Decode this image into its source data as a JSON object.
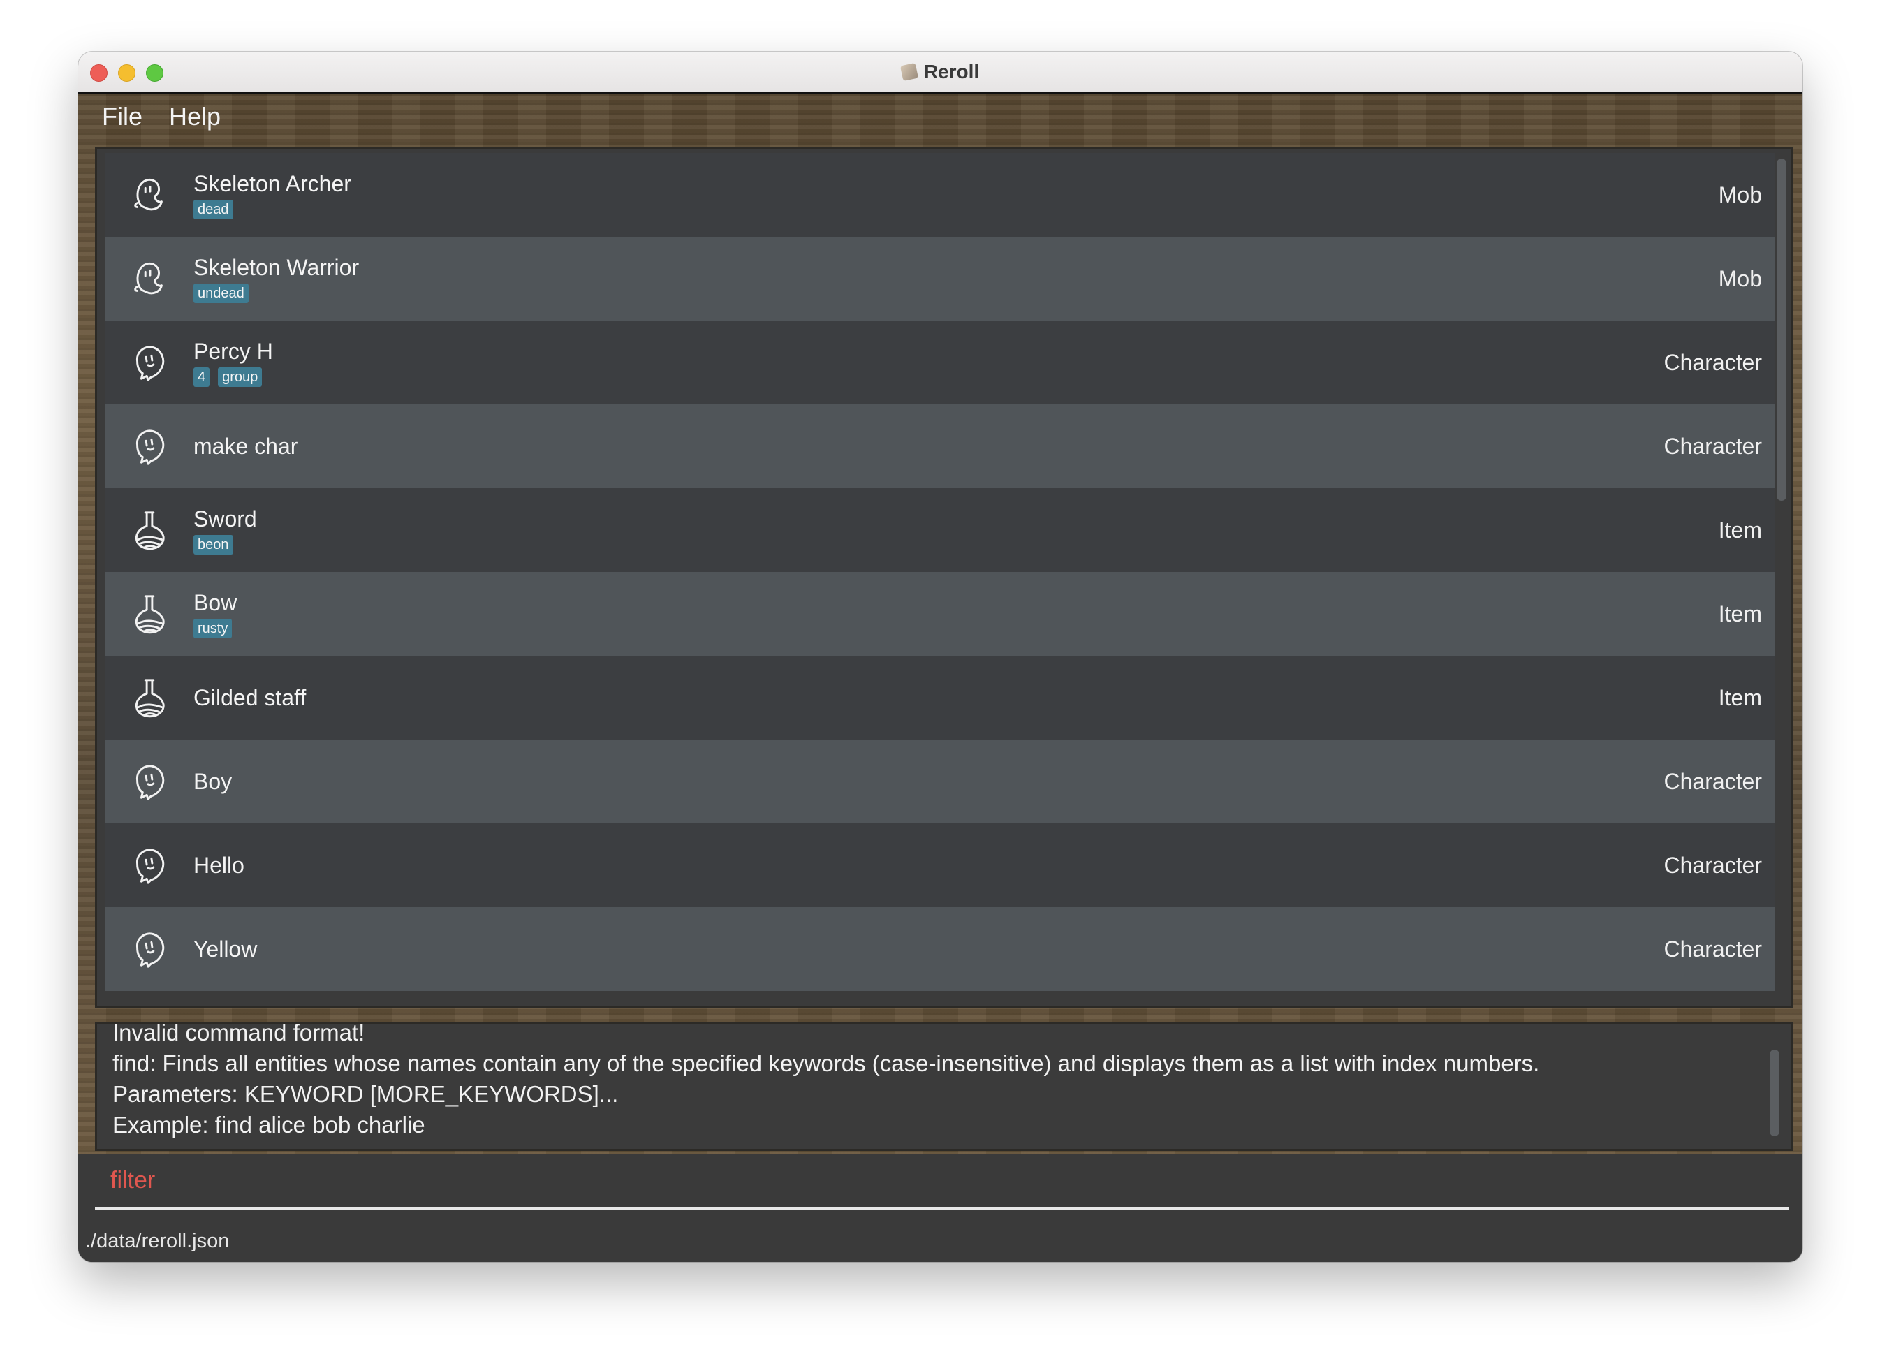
{
  "window": {
    "title": "Reroll"
  },
  "menu": {
    "file": "File",
    "help": "Help"
  },
  "entities": [
    {
      "name": "Skeleton Archer",
      "tags": [
        "dead"
      ],
      "type": "Mob",
      "icon": "ghost-icon"
    },
    {
      "name": "Skeleton Warrior",
      "tags": [
        "undead"
      ],
      "type": "Mob",
      "icon": "ghost-icon"
    },
    {
      "name": "Percy H",
      "tags": [
        "4",
        "group"
      ],
      "type": "Character",
      "icon": "character-icon"
    },
    {
      "name": "make char",
      "tags": [],
      "type": "Character",
      "icon": "character-icon"
    },
    {
      "name": "Sword",
      "tags": [
        "beon"
      ],
      "type": "Item",
      "icon": "potion-icon"
    },
    {
      "name": "Bow",
      "tags": [
        "rusty"
      ],
      "type": "Item",
      "icon": "potion-icon"
    },
    {
      "name": "Gilded staff",
      "tags": [],
      "type": "Item",
      "icon": "potion-icon"
    },
    {
      "name": "Boy",
      "tags": [],
      "type": "Character",
      "icon": "character-icon"
    },
    {
      "name": "Hello",
      "tags": [],
      "type": "Character",
      "icon": "character-icon"
    },
    {
      "name": "Yellow",
      "tags": [],
      "type": "Character",
      "icon": "character-icon"
    }
  ],
  "result": {
    "lines": [
      "Invalid command format!",
      "find: Finds all entities whose names contain any of the specified keywords (case-insensitive) and displays them as a list with index numbers.",
      "Parameters: KEYWORD [MORE_KEYWORDS]...",
      "Example: find alice bob charlie"
    ]
  },
  "command": {
    "value": "filter"
  },
  "status": {
    "path": "./data/reroll.json"
  }
}
